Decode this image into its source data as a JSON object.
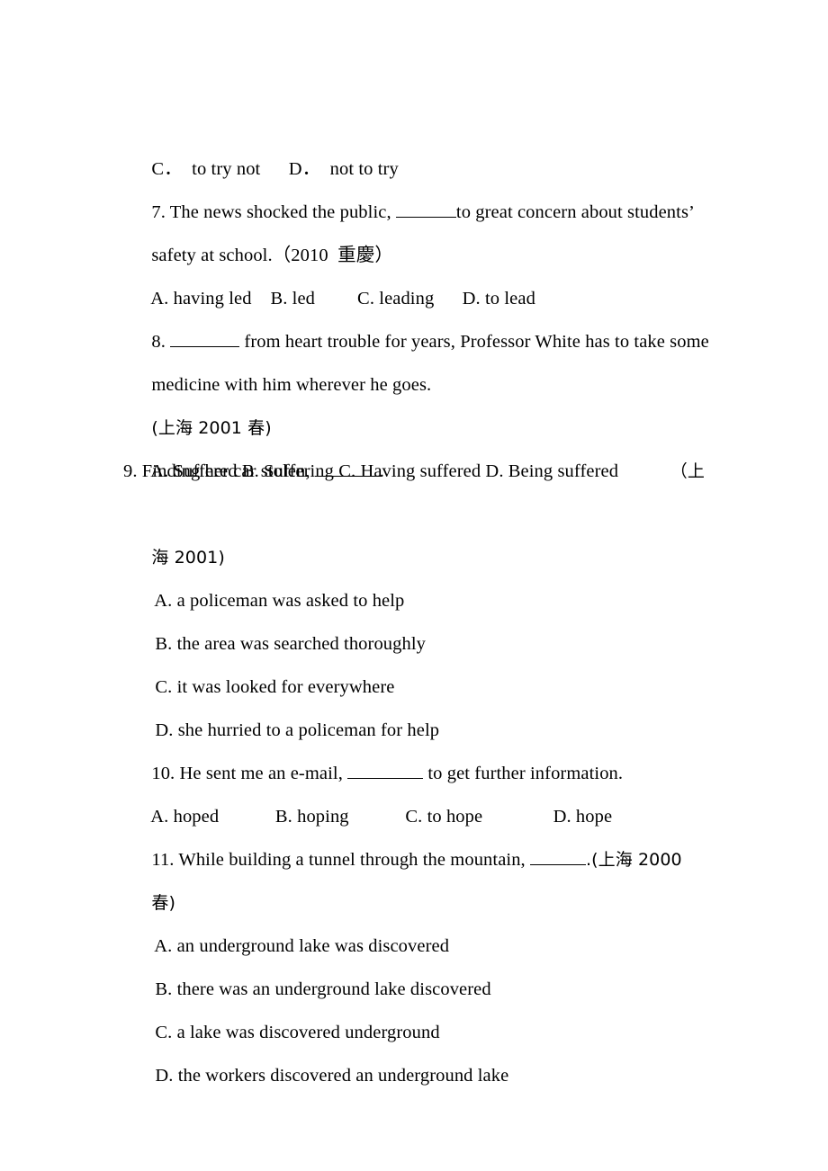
{
  "document": {
    "type": "grammar-exercise-worksheet",
    "language": "en-zh",
    "page_background": "#ffffff",
    "text_color": "#000000"
  },
  "lines": [
    {
      "id": "q6-options",
      "kind": "options-row",
      "text": "C．  to try not      D．  not to try"
    },
    {
      "id": "q7-stem-1",
      "kind": "question-stem",
      "before_blank": "7. The news shocked the public, ",
      "after_blank": "to great concern about students’"
    },
    {
      "id": "q7-stem-2",
      "kind": "question-stem-cont",
      "text": "safety at school.（2010  重慶）"
    },
    {
      "id": "q7-options",
      "kind": "options-row",
      "text": "A. having led    B. led         C. leading      D. to lead"
    },
    {
      "id": "q8-stem-1",
      "kind": "question-stem",
      "before_blank": "8. ",
      "after_blank": " from heart trouble for years, Professor White has to take some"
    },
    {
      "id": "q8-stem-2",
      "kind": "question-stem-cont",
      "text": "medicine with him wherever he goes."
    },
    {
      "id": "q8-source",
      "kind": "source-note",
      "text": "(上海 2001 春)"
    },
    {
      "id": "q8-options",
      "kind": "options-row",
      "text": "A. Suffered B. Suffering C. Having suffered D. Being suffered"
    },
    {
      "id": "q9-stem",
      "kind": "question-stem-split",
      "before_blank": "9. Finding her car stolen, ",
      "after_blank": ".",
      "trailing": "（上"
    },
    {
      "id": "q9-source-cont",
      "kind": "source-note",
      "text": "海 2001)"
    },
    {
      "id": "q9-option-a",
      "kind": "option",
      "text": "A. a policeman was asked to help"
    },
    {
      "id": "q9-option-b",
      "kind": "option",
      "text": "B. the area was searched thoroughly"
    },
    {
      "id": "q9-option-c",
      "kind": "option",
      "text": "C. it was looked for everywhere"
    },
    {
      "id": "q9-option-d",
      "kind": "option",
      "text": "D. she hurried to a policeman for help"
    },
    {
      "id": "q10-stem",
      "kind": "question-stem",
      "before_blank": "10. He sent me an e-mail, ",
      "after_blank": " to get further information."
    },
    {
      "id": "q10-options",
      "kind": "options-row",
      "text": "A. hoped            B. hoping            C. to hope               D. hope"
    },
    {
      "id": "q11-stem",
      "kind": "question-stem",
      "before_blank": "11. While building a tunnel through the mountain, ",
      "after_blank": ".(上海 2000"
    },
    {
      "id": "q11-source-cont",
      "kind": "source-note",
      "text": "春)"
    },
    {
      "id": "q11-option-a",
      "kind": "option",
      "text": "A. an underground lake was discovered"
    },
    {
      "id": "q11-option-b",
      "kind": "option",
      "text": "B. there was an underground lake discovered"
    },
    {
      "id": "q11-option-c",
      "kind": "option",
      "text": "C. a lake was discovered underground"
    },
    {
      "id": "q11-option-d",
      "kind": "option",
      "text": "D. the workers discovered an underground lake"
    }
  ]
}
